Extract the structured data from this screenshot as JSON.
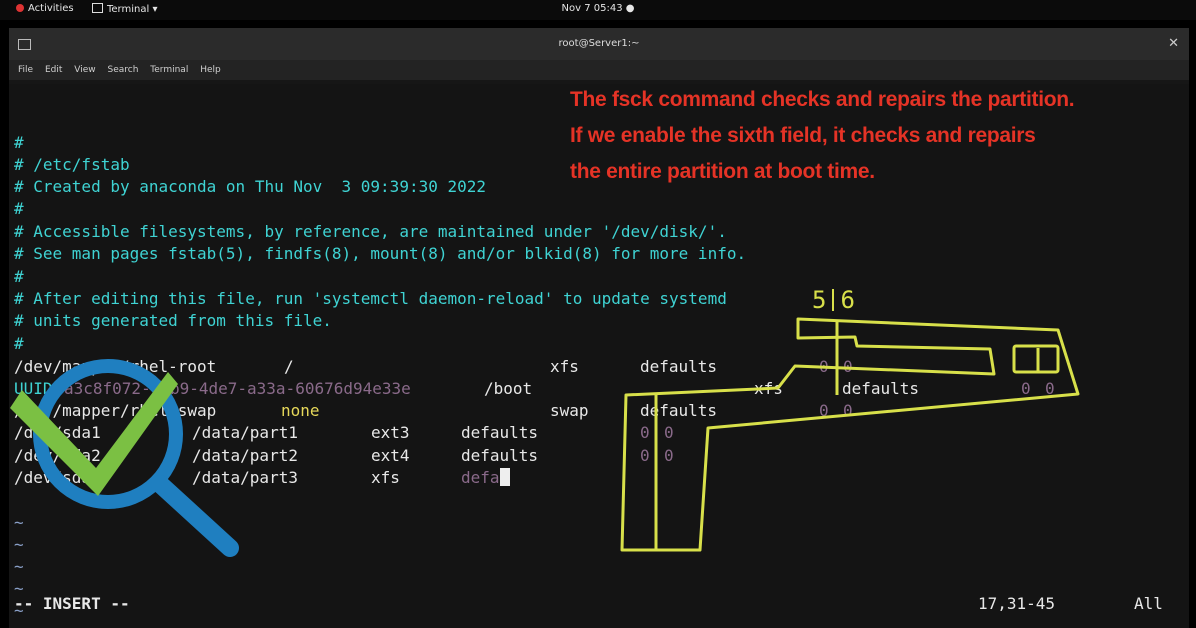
{
  "topbar": {
    "activities": "Activities",
    "app": "Terminal ▾",
    "clock": "Nov 7  05:43 ●"
  },
  "window": {
    "title": "root@Server1:~",
    "close": "✕",
    "menu": [
      "File",
      "Edit",
      "View",
      "Search",
      "Terminal",
      "Help"
    ]
  },
  "comments": [
    "#",
    "# /etc/fstab",
    "# Created by anaconda on Thu Nov  3 09:39:30 2022",
    "#",
    "# Accessible filesystems, by reference, are maintained under '/dev/disk/'.",
    "# See man pages fstab(5), findfs(8), mount(8) and/or blkid(8) for more info.",
    "#",
    "# After editing this file, run 'systemctl daemon-reload' to update systemd",
    "# units generated from this file.",
    "#"
  ],
  "entries": {
    "root": {
      "dev": "/dev/mapper/rhel-root",
      "mount": "/",
      "type": "xfs",
      "opts": "defaults",
      "f5": "0",
      "f6": "0"
    },
    "boot": {
      "uuid_prefix": "UUID=",
      "uuid_dim": "a3c8f072-07b9-4de7-a33a-60676d94e33e",
      "mount": "/boot",
      "type": "xfs",
      "opts": "defaults",
      "f5": "0",
      "f6": "0"
    },
    "swap": {
      "dev": "/dev/mapper/rhel-swap",
      "mount": "none",
      "type": "swap",
      "opts": "defaults",
      "f5": "0",
      "f6": "0"
    },
    "p1": {
      "dev": "/dev/sda1",
      "mount": "/data/part1",
      "type": "ext3",
      "opts": "defaults",
      "f5": "0",
      "f6": "0"
    },
    "p2": {
      "dev": "/dev/sda2",
      "mount": "/data/part2",
      "type": "ext4",
      "opts": "defaults",
      "f5": "0",
      "f6": "0"
    },
    "p3": {
      "dev": "/dev/sda3",
      "mount": "/data/part3",
      "type": "xfs",
      "opts": "defa"
    }
  },
  "tildes": [
    "~",
    "~",
    "~",
    "~",
    "~",
    "~"
  ],
  "annotation": {
    "lines": [
      "The fsck command checks and repairs the partition.",
      "If we enable the sixth field, it checks and repairs",
      "the entire partition at boot time."
    ],
    "field5": "5",
    "field6": "6"
  },
  "status": {
    "mode": "-- INSERT --",
    "position": "17,31-45",
    "scroll": "All"
  },
  "colors": {
    "comment": "#3fd3d3",
    "annotation": "#e53326",
    "highlight": "#d8e04a",
    "check": "#7bc043",
    "magnifier": "#1f7fc0"
  },
  "icons": [
    "magnifier-check-icon"
  ]
}
